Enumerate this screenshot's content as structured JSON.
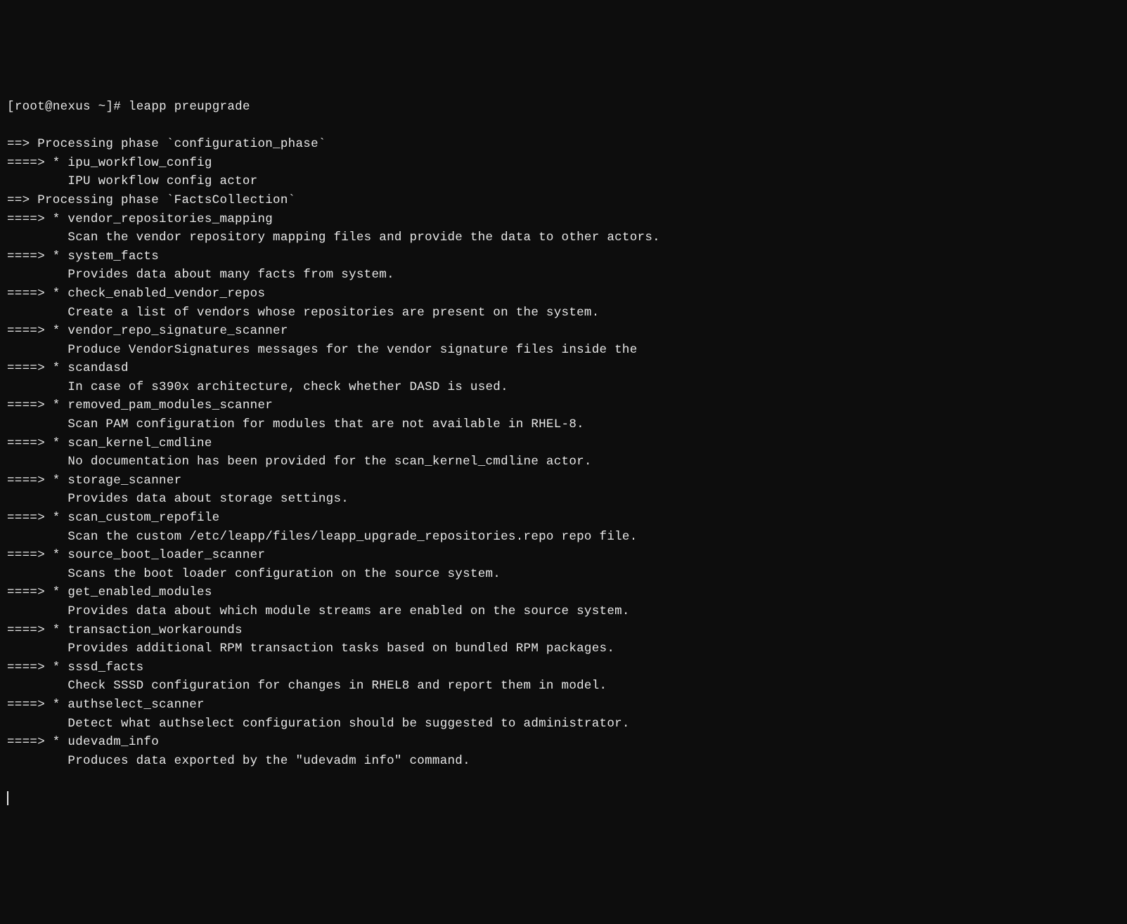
{
  "prompt": {
    "user": "root",
    "host": "nexus",
    "path": "~",
    "symbol": "#",
    "command": "leapp preupgrade"
  },
  "phases": [
    {
      "name": "configuration_phase",
      "actors": [
        {
          "name": "ipu_workflow_config",
          "description": "IPU workflow config actor"
        }
      ]
    },
    {
      "name": "FactsCollection",
      "actors": [
        {
          "name": "vendor_repositories_mapping",
          "description": "Scan the vendor repository mapping files and provide the data to other actors."
        },
        {
          "name": "system_facts",
          "description": "Provides data about many facts from system."
        },
        {
          "name": "check_enabled_vendor_repos",
          "description": "Create a list of vendors whose repositories are present on the system."
        },
        {
          "name": "vendor_repo_signature_scanner",
          "description": "Produce VendorSignatures messages for the vendor signature files inside the"
        },
        {
          "name": "scandasd",
          "description": "In case of s390x architecture, check whether DASD is used."
        },
        {
          "name": "removed_pam_modules_scanner",
          "description": "Scan PAM configuration for modules that are not available in RHEL-8."
        },
        {
          "name": "scan_kernel_cmdline",
          "description": "No documentation has been provided for the scan_kernel_cmdline actor."
        },
        {
          "name": "storage_scanner",
          "description": "Provides data about storage settings."
        },
        {
          "name": "scan_custom_repofile",
          "description": "Scan the custom /etc/leapp/files/leapp_upgrade_repositories.repo repo file."
        },
        {
          "name": "source_boot_loader_scanner",
          "description": "Scans the boot loader configuration on the source system."
        },
        {
          "name": "get_enabled_modules",
          "description": "Provides data about which module streams are enabled on the source system."
        },
        {
          "name": "transaction_workarounds",
          "description": "Provides additional RPM transaction tasks based on bundled RPM packages."
        },
        {
          "name": "sssd_facts",
          "description": "Check SSSD configuration for changes in RHEL8 and report them in model."
        },
        {
          "name": "authselect_scanner",
          "description": "Detect what authselect configuration should be suggested to administrator."
        },
        {
          "name": "udevadm_info",
          "description": "Produces data exported by the \"udevadm info\" command."
        }
      ]
    }
  ],
  "arrows": {
    "phase": "==>",
    "actor": "====>"
  }
}
